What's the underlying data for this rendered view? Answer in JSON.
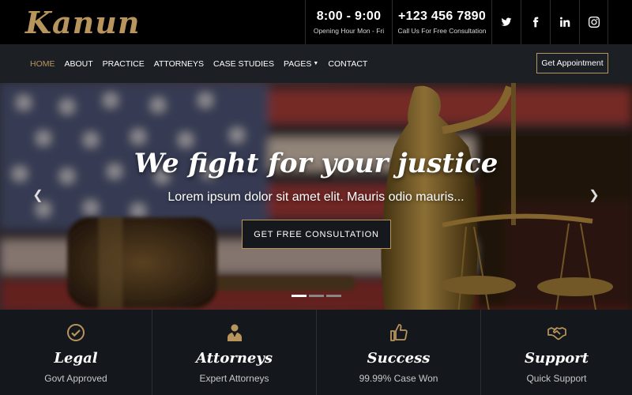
{
  "brand": {
    "logo": "Kanun"
  },
  "topbar": {
    "hours": {
      "value": "8:00 - 9:00",
      "label": "Opening Hour Mon - Fri"
    },
    "phone": {
      "value": "+123 456 7890",
      "label": "Call Us For Free Consultation"
    },
    "social": [
      "twitter-icon",
      "facebook-icon",
      "linkedin-icon",
      "instagram-icon"
    ]
  },
  "nav": {
    "items": [
      {
        "label": "HOME",
        "active": true
      },
      {
        "label": "ABOUT"
      },
      {
        "label": "PRACTICE"
      },
      {
        "label": "ATTORNEYS"
      },
      {
        "label": "CASE STUDIES"
      },
      {
        "label": "PAGES"
      },
      {
        "label": "CONTACT"
      }
    ],
    "appointment_label": "Get Appointment"
  },
  "hero": {
    "title": "We fight for your justice",
    "subtitle": "Lorem ipsum dolor sit amet elit. Mauris odio mauris...",
    "cta_label": "GET FREE CONSULTATION",
    "slides": 3,
    "active_slide": 1
  },
  "features": [
    {
      "icon": "check-circle-icon",
      "title": "Legal",
      "subtitle": "Govt Approved"
    },
    {
      "icon": "attorney-icon",
      "title": "Attorneys",
      "subtitle": "Expert Attorneys"
    },
    {
      "icon": "thumbs-up-icon",
      "title": "Success",
      "subtitle": "99.99% Case Won"
    },
    {
      "icon": "handshake-icon",
      "title": "Support",
      "subtitle": "Quick Support"
    }
  ],
  "colors": {
    "accent": "#b9955e",
    "topbar": "#000000",
    "nav": "#1c1f23",
    "features_bg": "#14171b"
  }
}
